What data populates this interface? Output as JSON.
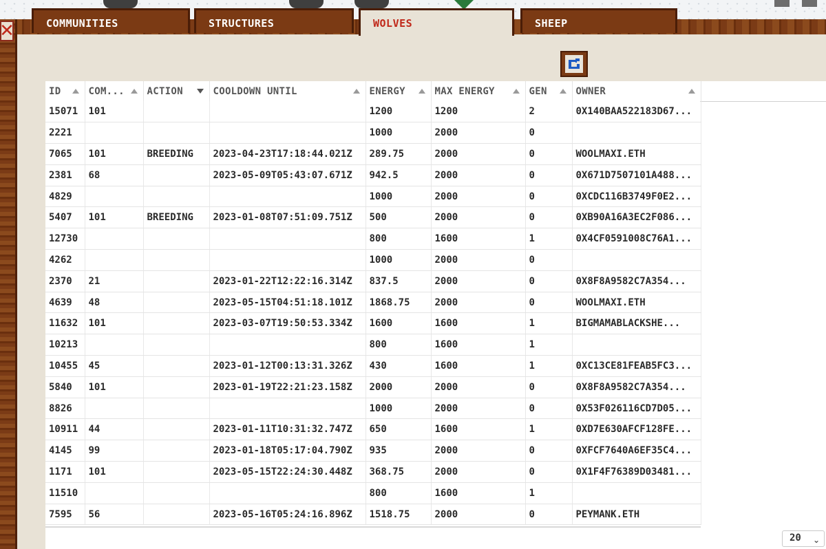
{
  "tabs": [
    {
      "label": "COMMUNITIES",
      "active": false
    },
    {
      "label": "STRUCTURES",
      "active": false
    },
    {
      "label": "WOLVES",
      "active": true
    },
    {
      "label": "SHEEP",
      "active": false
    }
  ],
  "accent_color": "#c0281a",
  "wood_color": "#7b3a14",
  "refresh_icon": "refresh-icon",
  "close_icon": "close-icon",
  "table": {
    "columns": [
      "ID",
      "COM...",
      "ACTION",
      "COOLDOWN UNTIL",
      "ENERGY",
      "MAX ENERGY",
      "GEN",
      "OWNER"
    ],
    "rows": [
      [
        "15071",
        "101",
        "",
        "",
        "1200",
        "1200",
        "2",
        "0X140BAA522183D67..."
      ],
      [
        "2221",
        "",
        "",
        "",
        "1000",
        "2000",
        "0",
        ""
      ],
      [
        "7065",
        "101",
        "BREEDING",
        "2023-04-23T17:18:44.021Z",
        "289.75",
        "2000",
        "0",
        "WOOLMAXI.ETH"
      ],
      [
        "2381",
        "68",
        "",
        "2023-05-09T05:43:07.671Z",
        "942.5",
        "2000",
        "0",
        "0X671D7507101A488..."
      ],
      [
        "4829",
        "",
        "",
        "",
        "1000",
        "2000",
        "0",
        "0XCDC116B3749F0E2..."
      ],
      [
        "5407",
        "101",
        "BREEDING",
        "2023-01-08T07:51:09.751Z",
        "500",
        "2000",
        "0",
        "0XB90A16A3EC2F086..."
      ],
      [
        "12730",
        "",
        "",
        "",
        "800",
        "1600",
        "1",
        "0X4CF0591008C76A1..."
      ],
      [
        "4262",
        "",
        "",
        "",
        "1000",
        "2000",
        "0",
        ""
      ],
      [
        "2370",
        "21",
        "",
        "2023-01-22T12:22:16.314Z",
        "837.5",
        "2000",
        "0",
        "0X8F8A9582C7A354..."
      ],
      [
        "4639",
        "48",
        "",
        "2023-05-15T04:51:18.101Z",
        "1868.75",
        "2000",
        "0",
        "WOOLMAXI.ETH"
      ],
      [
        "11632",
        "101",
        "",
        "2023-03-07T19:50:53.334Z",
        "1600",
        "1600",
        "1",
        "BIGMAMABLACKSHE..."
      ],
      [
        "10213",
        "",
        "",
        "",
        "800",
        "1600",
        "1",
        ""
      ],
      [
        "10455",
        "45",
        "",
        "2023-01-12T00:13:31.326Z",
        "430",
        "1600",
        "1",
        "0XC13CE81FEAB5FC3..."
      ],
      [
        "5840",
        "101",
        "",
        "2023-01-19T22:21:23.158Z",
        "2000",
        "2000",
        "0",
        "0X8F8A9582C7A354..."
      ],
      [
        "8826",
        "",
        "",
        "",
        "1000",
        "2000",
        "0",
        "0X53F026116CD7D05..."
      ],
      [
        "10911",
        "44",
        "",
        "2023-01-11T10:31:32.747Z",
        "650",
        "1600",
        "1",
        "0XD7E630AFCF128FE..."
      ],
      [
        "4145",
        "99",
        "",
        "2023-01-18T05:17:04.790Z",
        "935",
        "2000",
        "0",
        "0XFCF7640A6EF35C4..."
      ],
      [
        "1171",
        "101",
        "",
        "2023-05-15T22:24:30.448Z",
        "368.75",
        "2000",
        "0",
        "0X1F4F76389D03481..."
      ],
      [
        "11510",
        "",
        "",
        "",
        "800",
        "1600",
        "1",
        ""
      ],
      [
        "7595",
        "56",
        "",
        "2023-05-16T05:24:16.896Z",
        "1518.75",
        "2000",
        "0",
        "PEYMANK.ETH"
      ]
    ]
  },
  "page_size": {
    "selected": "20"
  }
}
